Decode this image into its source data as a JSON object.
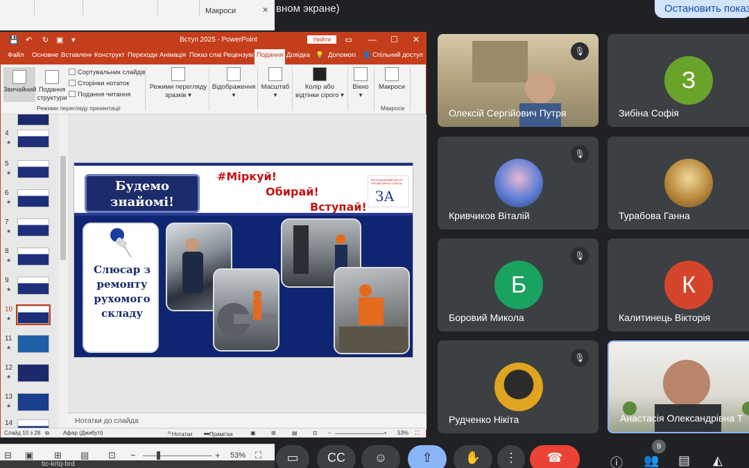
{
  "meet": {
    "top_text": "вном экране)",
    "stop_button": "Остановить показ",
    "participant_count": "9",
    "tiles": [
      {
        "name": "Олексій Сергійович Путря",
        "initial": "",
        "color": ""
      },
      {
        "name": "Зибіна Софія",
        "initial": "З",
        "color": "#6aa32a"
      },
      {
        "name": "Кривчиков Віталій",
        "initial": "",
        "color": "#2a6fbf"
      },
      {
        "name": "Турабова Ганна",
        "initial": "",
        "color": "#c29a3c"
      },
      {
        "name": "Боровий Микола",
        "initial": "Б",
        "color": "#1aa260"
      },
      {
        "name": "Калитинець Вікторія",
        "initial": "К",
        "color": "#d5452b"
      },
      {
        "name": "Рудченко Нікіта",
        "initial": "",
        "color": "#e0a420"
      },
      {
        "name": "Анастасія Олександрівна Т",
        "initial": "",
        "color": ""
      }
    ]
  },
  "bg_ppt": {
    "macro_label": "Макроси",
    "zoom": "53%",
    "taskbar_text": "tic-krtq-brd"
  },
  "ppt": {
    "title": "Вступ 2025  -  PowerPoint",
    "signin": "Увійти",
    "tabs": [
      "Файл",
      "Основне",
      "Вставлення",
      "Конструктор",
      "Переходи",
      "Анімація",
      "Показ слайдів",
      "Рецензування",
      "Подання",
      "Довідка",
      "Допомога",
      "Спільний доступ"
    ],
    "ribbon": {
      "normal": "Звичайний",
      "outline": "Подання структури",
      "sorter": "Сортувальник слайдів",
      "notes_page": "Сторінки нотаток",
      "reading": "Подання читання",
      "group_views": "Режими перегляду презентації",
      "master_views": "Режими перегляду зразків",
      "show": "Відображення",
      "zoom": "Масштаб",
      "color": "Колір або відтінки сірого",
      "window": "Вікно",
      "macros": "Макроси",
      "group_macros": "Макроси"
    },
    "thumbs": [
      "4",
      "5",
      "6",
      "7",
      "8",
      "9",
      "10",
      "11",
      "12",
      "13",
      "14"
    ],
    "active_thumb": "10",
    "notes_placeholder": "Нотатки до слайда",
    "status": {
      "slide": "Слайд 10 з 28",
      "lang": "Афар (Джибуті)",
      "notes": "Нотатки",
      "comments": "Примітки",
      "zoom": "53%"
    },
    "slide": {
      "hello": "Будемо знайомі!",
      "motto1": "#Міркуй!",
      "motto2": "Обирай!",
      "motto3": "Вступай!",
      "logo_letters": "ЗА",
      "logo_text": "РЕГІОНАЛЬНИЙ ЦЕНТР ПРОФЕСІЙНОЇ ОСВІТИ",
      "card_text": "Слюсар з ремонту рухомого складу"
    }
  }
}
